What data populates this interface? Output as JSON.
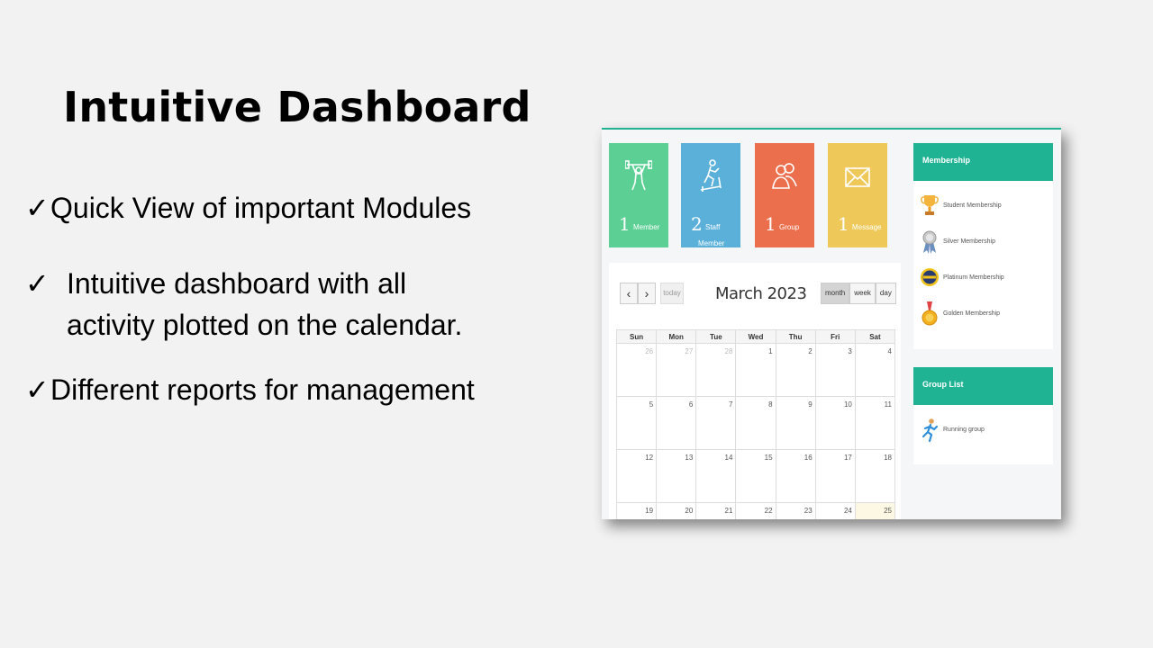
{
  "slide": {
    "title": "Intuitive Dashboard",
    "check": "✓",
    "bullets": [
      "Quick View of important Modules",
      "Intuitive dashboard with all",
      "activity plotted on the calendar.",
      "Different reports for management"
    ]
  },
  "tiles": [
    {
      "count": "1",
      "label": "Member",
      "icon": "weightlifter-icon",
      "color": "#5bcf94"
    },
    {
      "count": "2",
      "label": "Staff",
      "label2": "Member",
      "icon": "treadmill-icon",
      "color": "#5bb0d9"
    },
    {
      "count": "1",
      "label": "Group",
      "icon": "users-icon",
      "color": "#ec6f4d"
    },
    {
      "count": "1",
      "label": "Message",
      "icon": "envelope-icon",
      "color": "#eec959"
    }
  ],
  "calendar": {
    "title": "March 2023",
    "prev": "‹",
    "next": "›",
    "today": "today",
    "views": [
      "month",
      "week",
      "day"
    ],
    "days": [
      "Sun",
      "Mon",
      "Tue",
      "Wed",
      "Thu",
      "Fri",
      "Sat"
    ],
    "weeks": [
      [
        "26",
        "27",
        "28",
        "1",
        "2",
        "3",
        "4"
      ],
      [
        "5",
        "6",
        "7",
        "8",
        "9",
        "10",
        "11"
      ],
      [
        "12",
        "13",
        "14",
        "15",
        "16",
        "17",
        "18"
      ],
      [
        "19",
        "20",
        "21",
        "22",
        "23",
        "24",
        "25"
      ]
    ]
  },
  "membership": {
    "header": "Membership",
    "items": [
      {
        "label": "Student Membership",
        "icon": "trophy-icon"
      },
      {
        "label": "Silver Membership",
        "icon": "ribbon-icon"
      },
      {
        "label": "Platinum Membership",
        "icon": "platinum-badge-icon"
      },
      {
        "label": "Golden Membership",
        "icon": "gold-medal-icon"
      }
    ]
  },
  "group_list": {
    "header": "Group List",
    "items": [
      {
        "label": "Running group",
        "icon": "runner-icon"
      }
    ]
  },
  "colors": {
    "accent": "#1fb394"
  }
}
